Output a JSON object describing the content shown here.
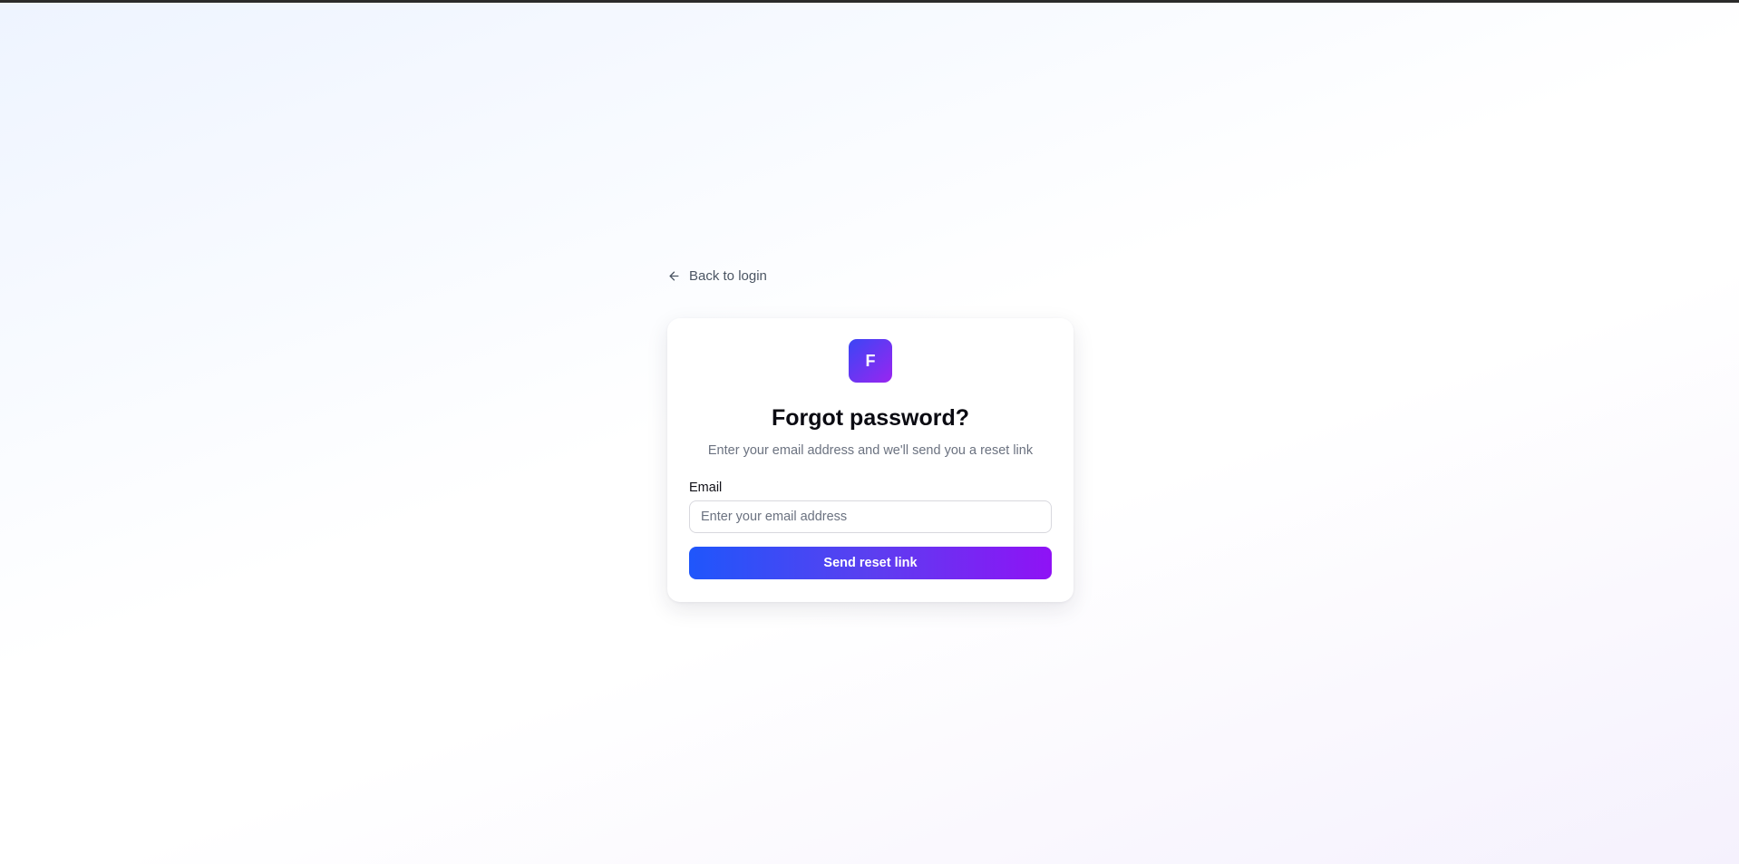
{
  "back_link": {
    "label": "Back to login",
    "icon": "arrow-left-icon"
  },
  "card": {
    "logo_letter": "F",
    "title": "Forgot password?",
    "subtitle": "Enter your email address and we'll send you a reset link",
    "email": {
      "label": "Email",
      "placeholder": "Enter your email address",
      "value": ""
    },
    "submit_label": "Send reset link"
  },
  "colors": {
    "accent_start": "#1f56fb",
    "accent_end": "#8f12f5",
    "logo_start": "#3b46f5",
    "logo_end": "#9a25f0"
  }
}
